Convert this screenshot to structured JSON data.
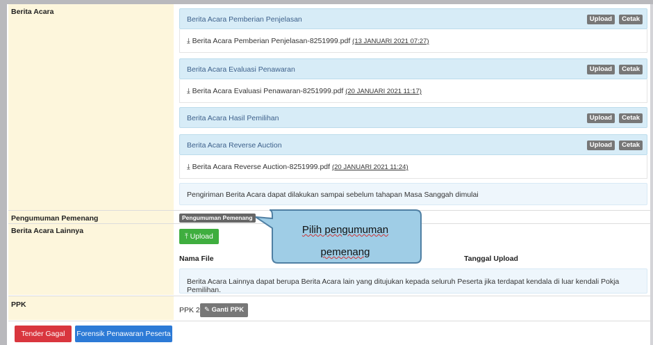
{
  "sections": {
    "berita_acara": "Berita Acara",
    "pengumuman_pemenang": "Pengumuman Pemenang",
    "berita_acara_lainnya": "Berita Acara Lainnya",
    "ppk": "PPK"
  },
  "buttons": {
    "upload": "Upload",
    "cetak": "Cetak"
  },
  "berita_acara_items": [
    {
      "title": "Berita Acara Pemberian Penjelasan",
      "file": "Berita Acara Pemberian Penjelasan-8251999.pdf",
      "date": "(13 JANUARI 2021 07:27)"
    },
    {
      "title": "Berita Acara Evaluasi Penawaran",
      "file": "Berita Acara Evaluasi Penawaran-8251999.pdf",
      "date": "(20 JANUARI 2021 11:17)"
    },
    {
      "title": "Berita Acara Hasil Pemilihan"
    },
    {
      "title": "Berita Acara Reverse Auction",
      "file": "Berita Acara Reverse Auction-8251999.pdf",
      "date": "(20 JANUARI 2021 11:24)"
    }
  ],
  "notes": {
    "berita_acara": "Pengiriman Berita Acara dapat dilakukan sampai sebelum tahapan Masa Sanggah dimulai",
    "lainnya": "Berita Acara Lainnya dapat berupa Berita Acara lain yang ditujukan kepada seluruh Peserta jika terdapat kendala di luar kendali Pokja Pemilihan."
  },
  "pengumuman_button": "Pengumuman Pemenang",
  "lainnya": {
    "upload_label": "Upload",
    "columns": [
      "Nama File",
      "Tanggal Upload"
    ]
  },
  "ppk": {
    "value": "PPK 2",
    "ganti_label": "Ganti PPK"
  },
  "footer": {
    "tender_gagal": "Tender Gagal",
    "forensik": "Forensik Penawaran Peserta"
  },
  "callout": {
    "line1": "Pilih pengumuman",
    "line2": "pemenang"
  },
  "colors": {
    "upload_green": "#3fae3f",
    "danger_red": "#d9363e",
    "primary_blue": "#2c7ad6",
    "callout_fill": "#9fcde6"
  }
}
